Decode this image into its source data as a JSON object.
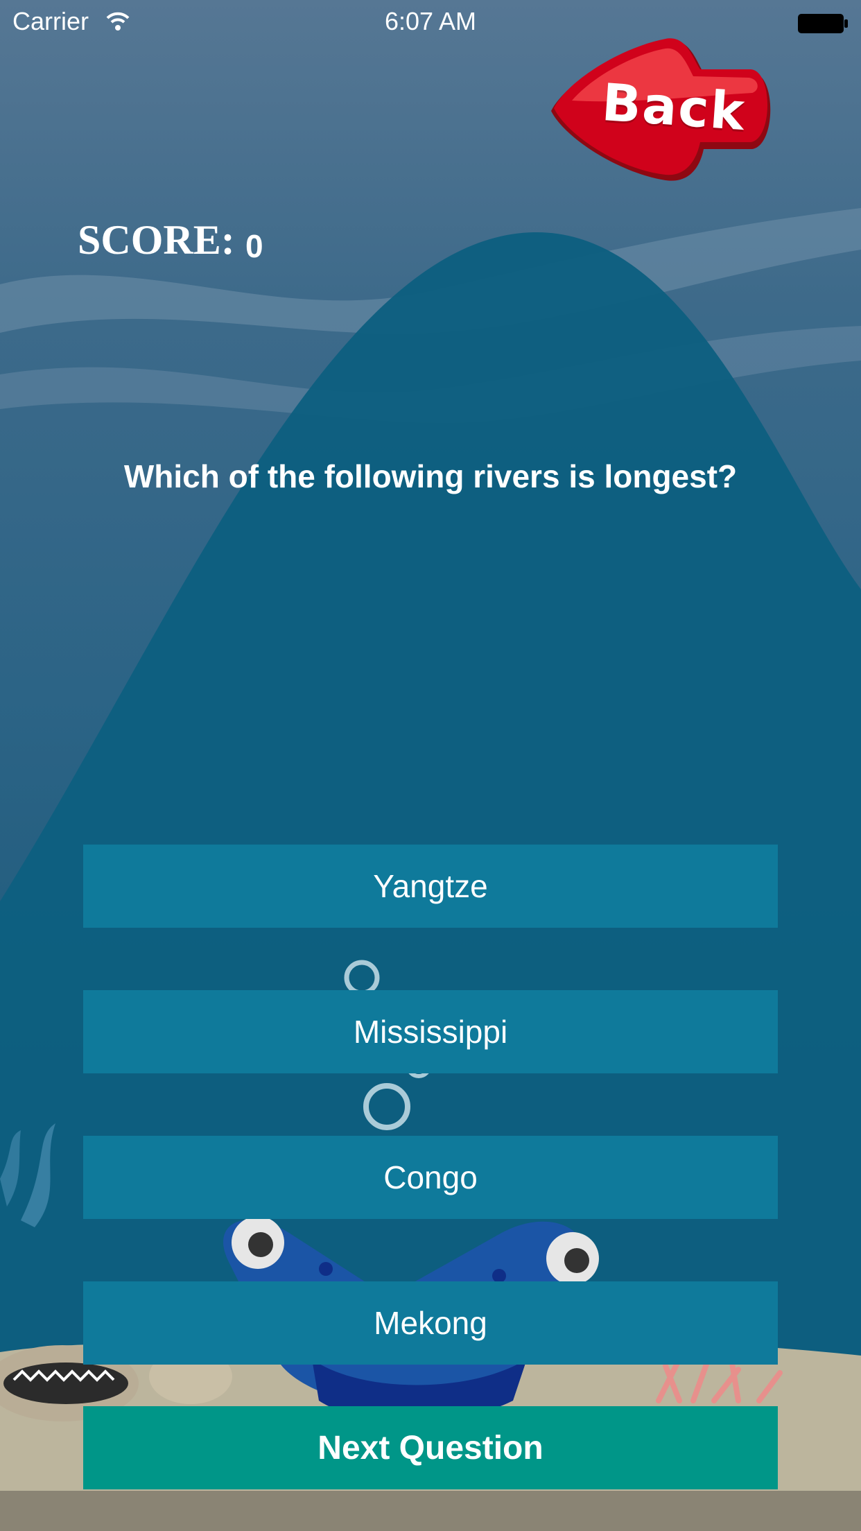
{
  "status_bar": {
    "carrier": "Carrier",
    "time": "6:07 AM"
  },
  "back_button": {
    "label": "Back",
    "color": "#d0021b"
  },
  "score": {
    "label": "SCORE:",
    "value": "0"
  },
  "question": {
    "text": "Which of the following rivers is longest?"
  },
  "answers": [
    {
      "label": "Yangtze"
    },
    {
      "label": "Mississippi"
    },
    {
      "label": "Congo"
    },
    {
      "label": "Mekong"
    }
  ],
  "next_button": {
    "label": "Next Question",
    "color": "#009688"
  },
  "colors": {
    "answer_button": "#0f7a9b",
    "text": "#ffffff"
  }
}
